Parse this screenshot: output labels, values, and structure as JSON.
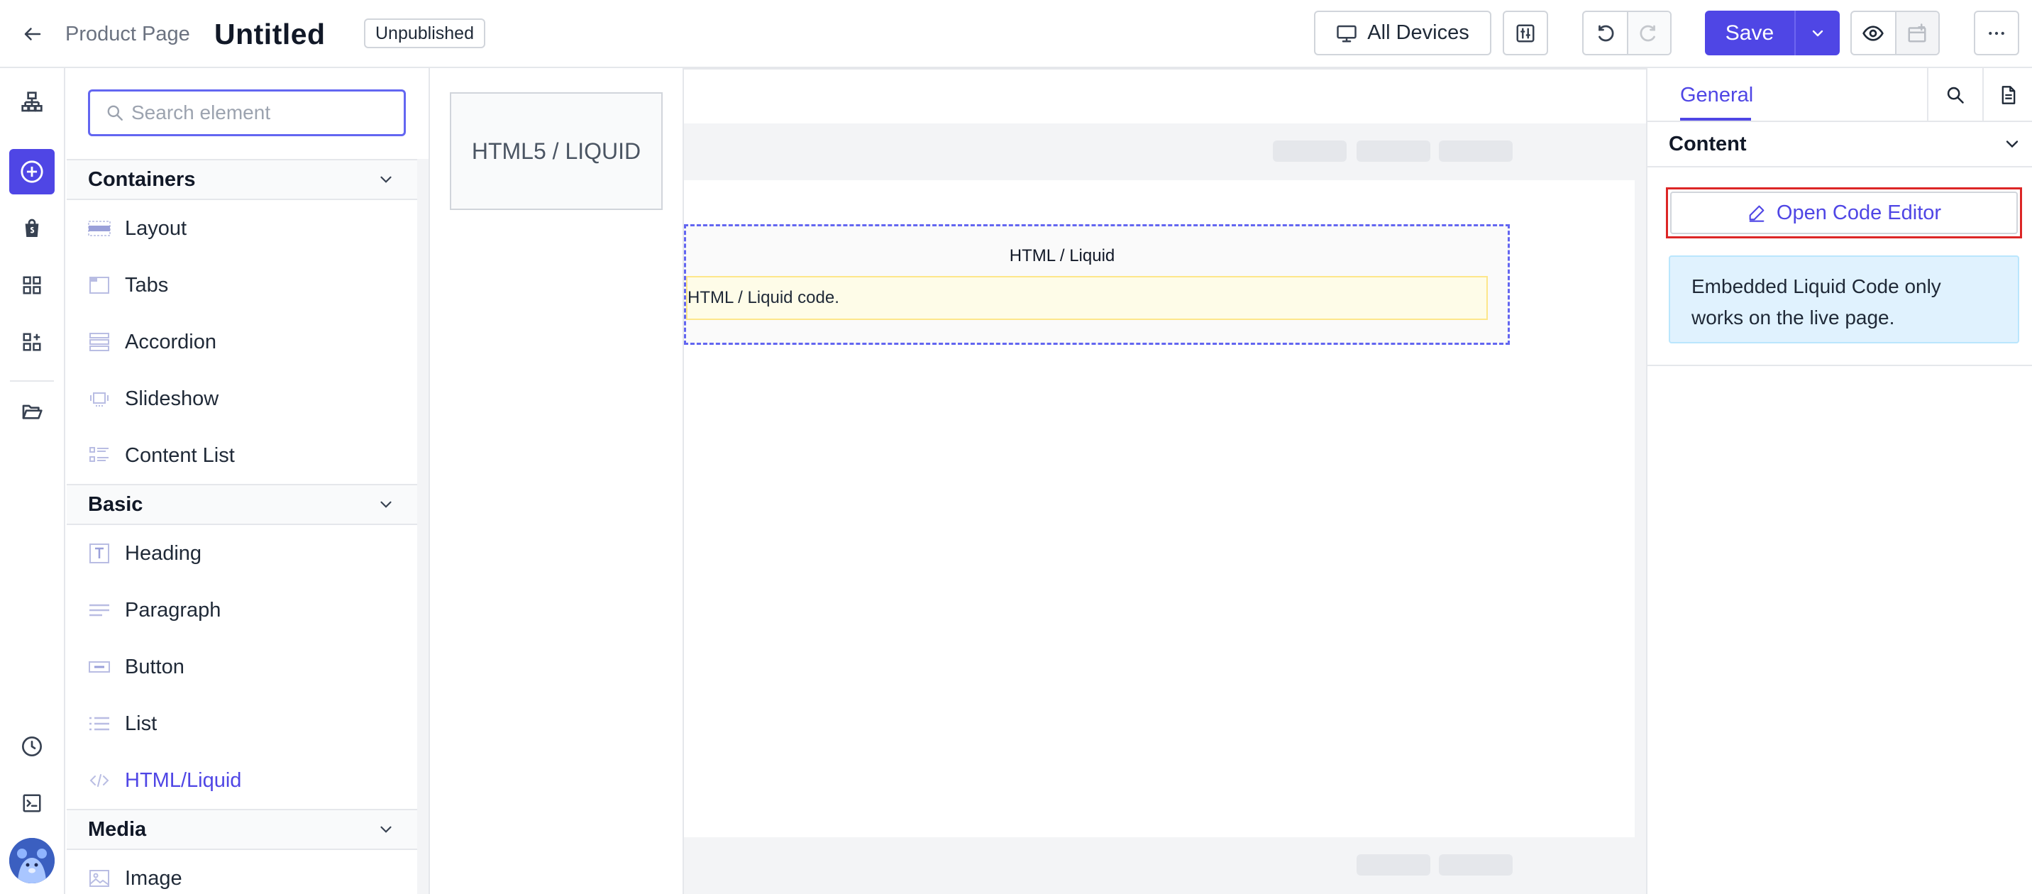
{
  "header": {
    "breadcrumb": "Product Page",
    "title": "Untitled",
    "status_badge": "Unpublished",
    "devices_label": "All Devices",
    "save_label": "Save"
  },
  "elements_panel": {
    "search_placeholder": "Search element",
    "categories": [
      {
        "title": "Containers",
        "items": [
          "Layout",
          "Tabs",
          "Accordion",
          "Slideshow",
          "Content List"
        ]
      },
      {
        "title": "Basic",
        "items": [
          "Heading",
          "Paragraph",
          "Button",
          "List",
          "HTML/Liquid"
        ]
      },
      {
        "title": "Media",
        "items": [
          "Image"
        ]
      }
    ],
    "selected_item": "HTML/Liquid"
  },
  "canvas": {
    "preview_card_label": "HTML5 / LIQUID",
    "block_title": "HTML / Liquid",
    "block_note": "HTML / Liquid code."
  },
  "settings_panel": {
    "tab_general": "General",
    "section_title": "Content",
    "open_code_editor_label": "Open Code Editor",
    "info_text": "Embedded Liquid Code only works on the live page."
  },
  "colors": {
    "accent": "#4f46e5",
    "highlight_border": "#dc2626",
    "info_bg": "#e0f2fe",
    "note_bg": "#fefce8"
  }
}
